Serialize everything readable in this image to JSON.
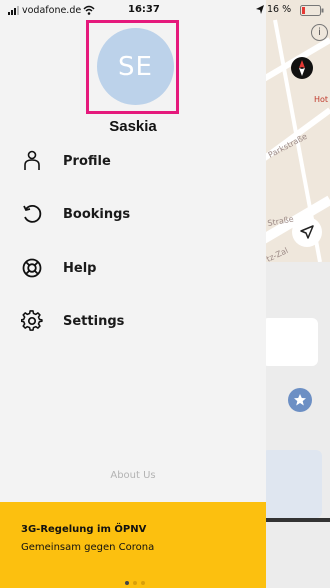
{
  "status_bar": {
    "carrier": "vodafone.de",
    "time": "16:37",
    "battery": "16 %"
  },
  "map": {
    "streets": [
      "Parkstraße",
      "Straße",
      "tz-Zal",
      "Hot"
    ]
  },
  "drawer": {
    "avatar_initials": "SE",
    "user_name": "Saskia",
    "menu": [
      {
        "label": "Profile",
        "icon": "person-icon"
      },
      {
        "label": "Bookings",
        "icon": "history-icon"
      },
      {
        "label": "Help",
        "icon": "lifebuoy-icon"
      },
      {
        "label": "Settings",
        "icon": "gear-icon"
      }
    ],
    "about_us": "About Us",
    "banner": {
      "title": "3G-Regelung im ÖPNV",
      "subtitle": "Gemeinsam gegen Corona",
      "active_page": 1,
      "page_count": 3
    }
  },
  "info_icon": "i",
  "colors": {
    "banner": "#fcc00f",
    "avatar": "#bcd2ea",
    "highlight_frame": "#e5197c",
    "star_button": "#6c8fc4"
  }
}
